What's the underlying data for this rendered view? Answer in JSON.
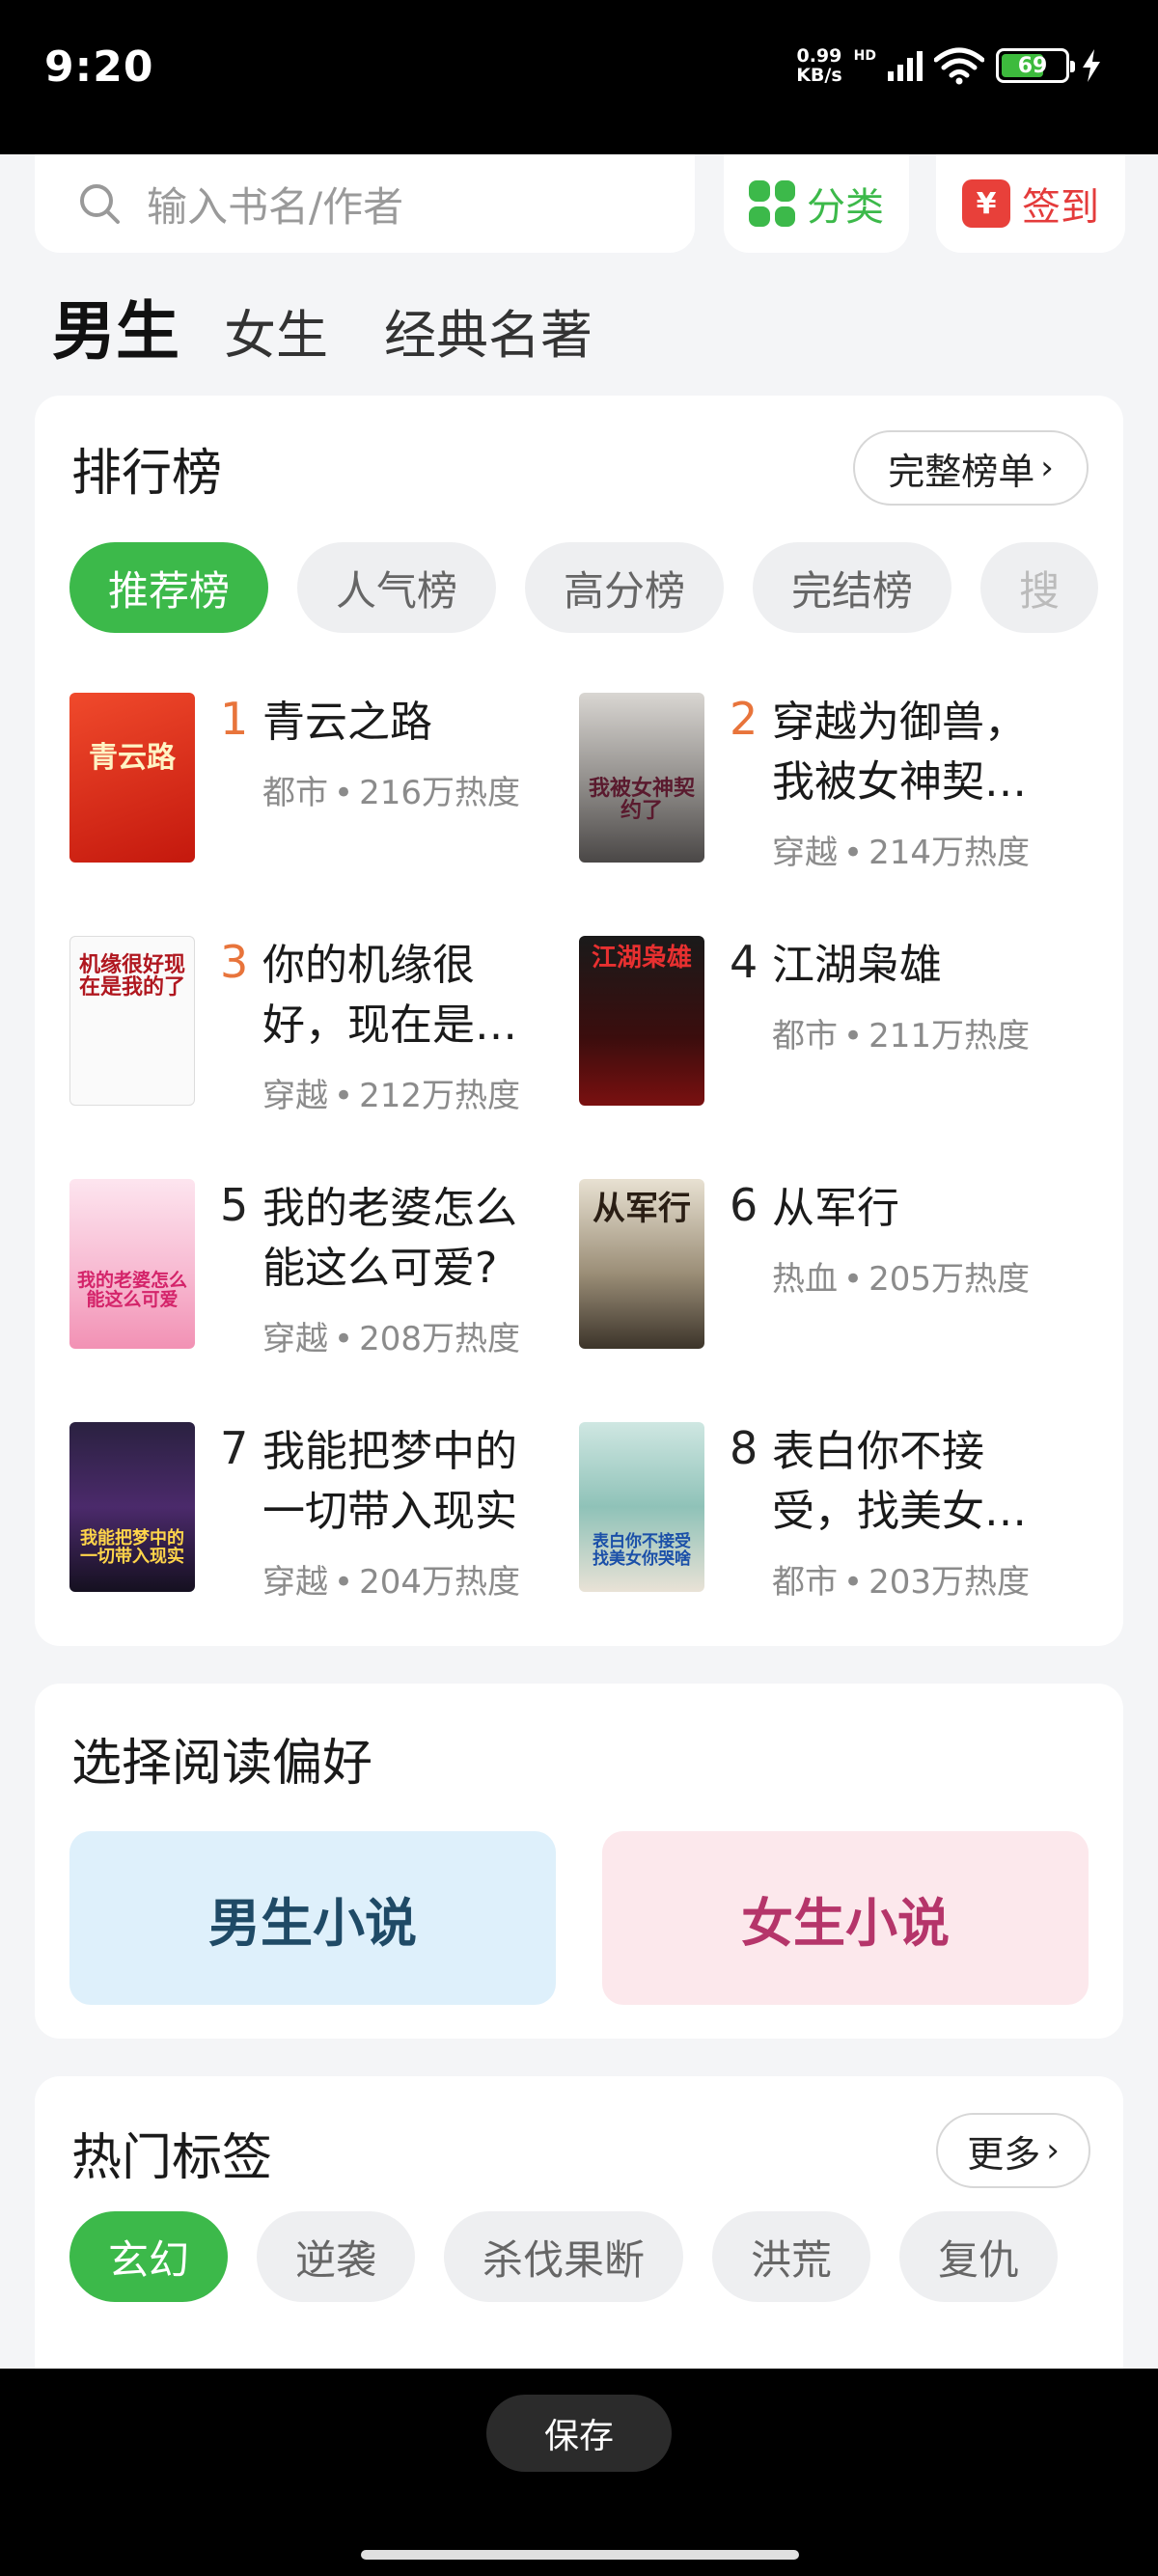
{
  "status": {
    "time": "9:20",
    "net_speed": "0.99",
    "net_unit": "KB/s",
    "network": "HD",
    "battery": "69",
    "icons": [
      "signal-icon",
      "wifi-icon",
      "battery-icon",
      "charging-icon"
    ]
  },
  "search": {
    "placeholder": "输入书名/作者",
    "icon": "search-icon"
  },
  "top_buttons": {
    "category": {
      "label": "分类",
      "icon": "grid-icon",
      "color": "#3cb94a"
    },
    "signin": {
      "label": "签到",
      "icon": "calendar-icon",
      "icon_text": "¥",
      "color": "#e43b3b"
    }
  },
  "gender_tabs": [
    {
      "label": "男生",
      "active": true
    },
    {
      "label": "女生",
      "active": false
    },
    {
      "label": "经典名著",
      "active": false
    }
  ],
  "ranking": {
    "title": "排行榜",
    "more_label": "完整榜单",
    "tabs": [
      {
        "label": "推荐榜",
        "active": true
      },
      {
        "label": "人气榜",
        "active": false
      },
      {
        "label": "高分榜",
        "active": false
      },
      {
        "label": "完结榜",
        "active": false
      },
      {
        "label": "搜",
        "active": false
      }
    ],
    "books": [
      {
        "rank": "1",
        "title": "青云之路",
        "genre": "都市",
        "heat": "216万热度",
        "cover_text": "青云路"
      },
      {
        "rank": "2",
        "title": "穿越为御兽，我被女神契…",
        "genre": "穿越",
        "heat": "214万热度",
        "cover_text": "我被女神契约了"
      },
      {
        "rank": "3",
        "title": "你的机缘很好，现在是…",
        "genre": "穿越",
        "heat": "212万热度",
        "cover_text": "机缘很好现在是我的了"
      },
      {
        "rank": "4",
        "title": "江湖枭雄",
        "genre": "都市",
        "heat": "211万热度",
        "cover_text": "江湖枭雄"
      },
      {
        "rank": "5",
        "title": "我的老婆怎么能这么可爱?",
        "genre": "穿越",
        "heat": "208万热度",
        "cover_text": "我的老婆怎么能这么可爱"
      },
      {
        "rank": "6",
        "title": "从军行",
        "genre": "热血",
        "heat": "205万热度",
        "cover_text": "从军行"
      },
      {
        "rank": "7",
        "title": "我能把梦中的一切带入现实",
        "genre": "穿越",
        "heat": "204万热度",
        "cover_text": "我能把梦中的一切带入现实"
      },
      {
        "rank": "8",
        "title": "表白你不接受，找美女…",
        "genre": "都市",
        "heat": "203万热度",
        "cover_text": "表白你不接受找美女你哭啥"
      }
    ],
    "rank_colors": {
      "top": "#e8743b",
      "other": "#222222"
    }
  },
  "preference": {
    "title": "选择阅读偏好",
    "male": "男生小说",
    "female": "女生小说"
  },
  "hot_tags": {
    "title": "热门标签",
    "more_label": "更多",
    "tags": [
      {
        "label": "玄幻",
        "active": true
      },
      {
        "label": "逆袭",
        "active": false
      },
      {
        "label": "杀伐果断",
        "active": false
      },
      {
        "label": "洪荒",
        "active": false
      },
      {
        "label": "复仇",
        "active": false
      }
    ]
  },
  "bottom": {
    "save_label": "保存"
  }
}
